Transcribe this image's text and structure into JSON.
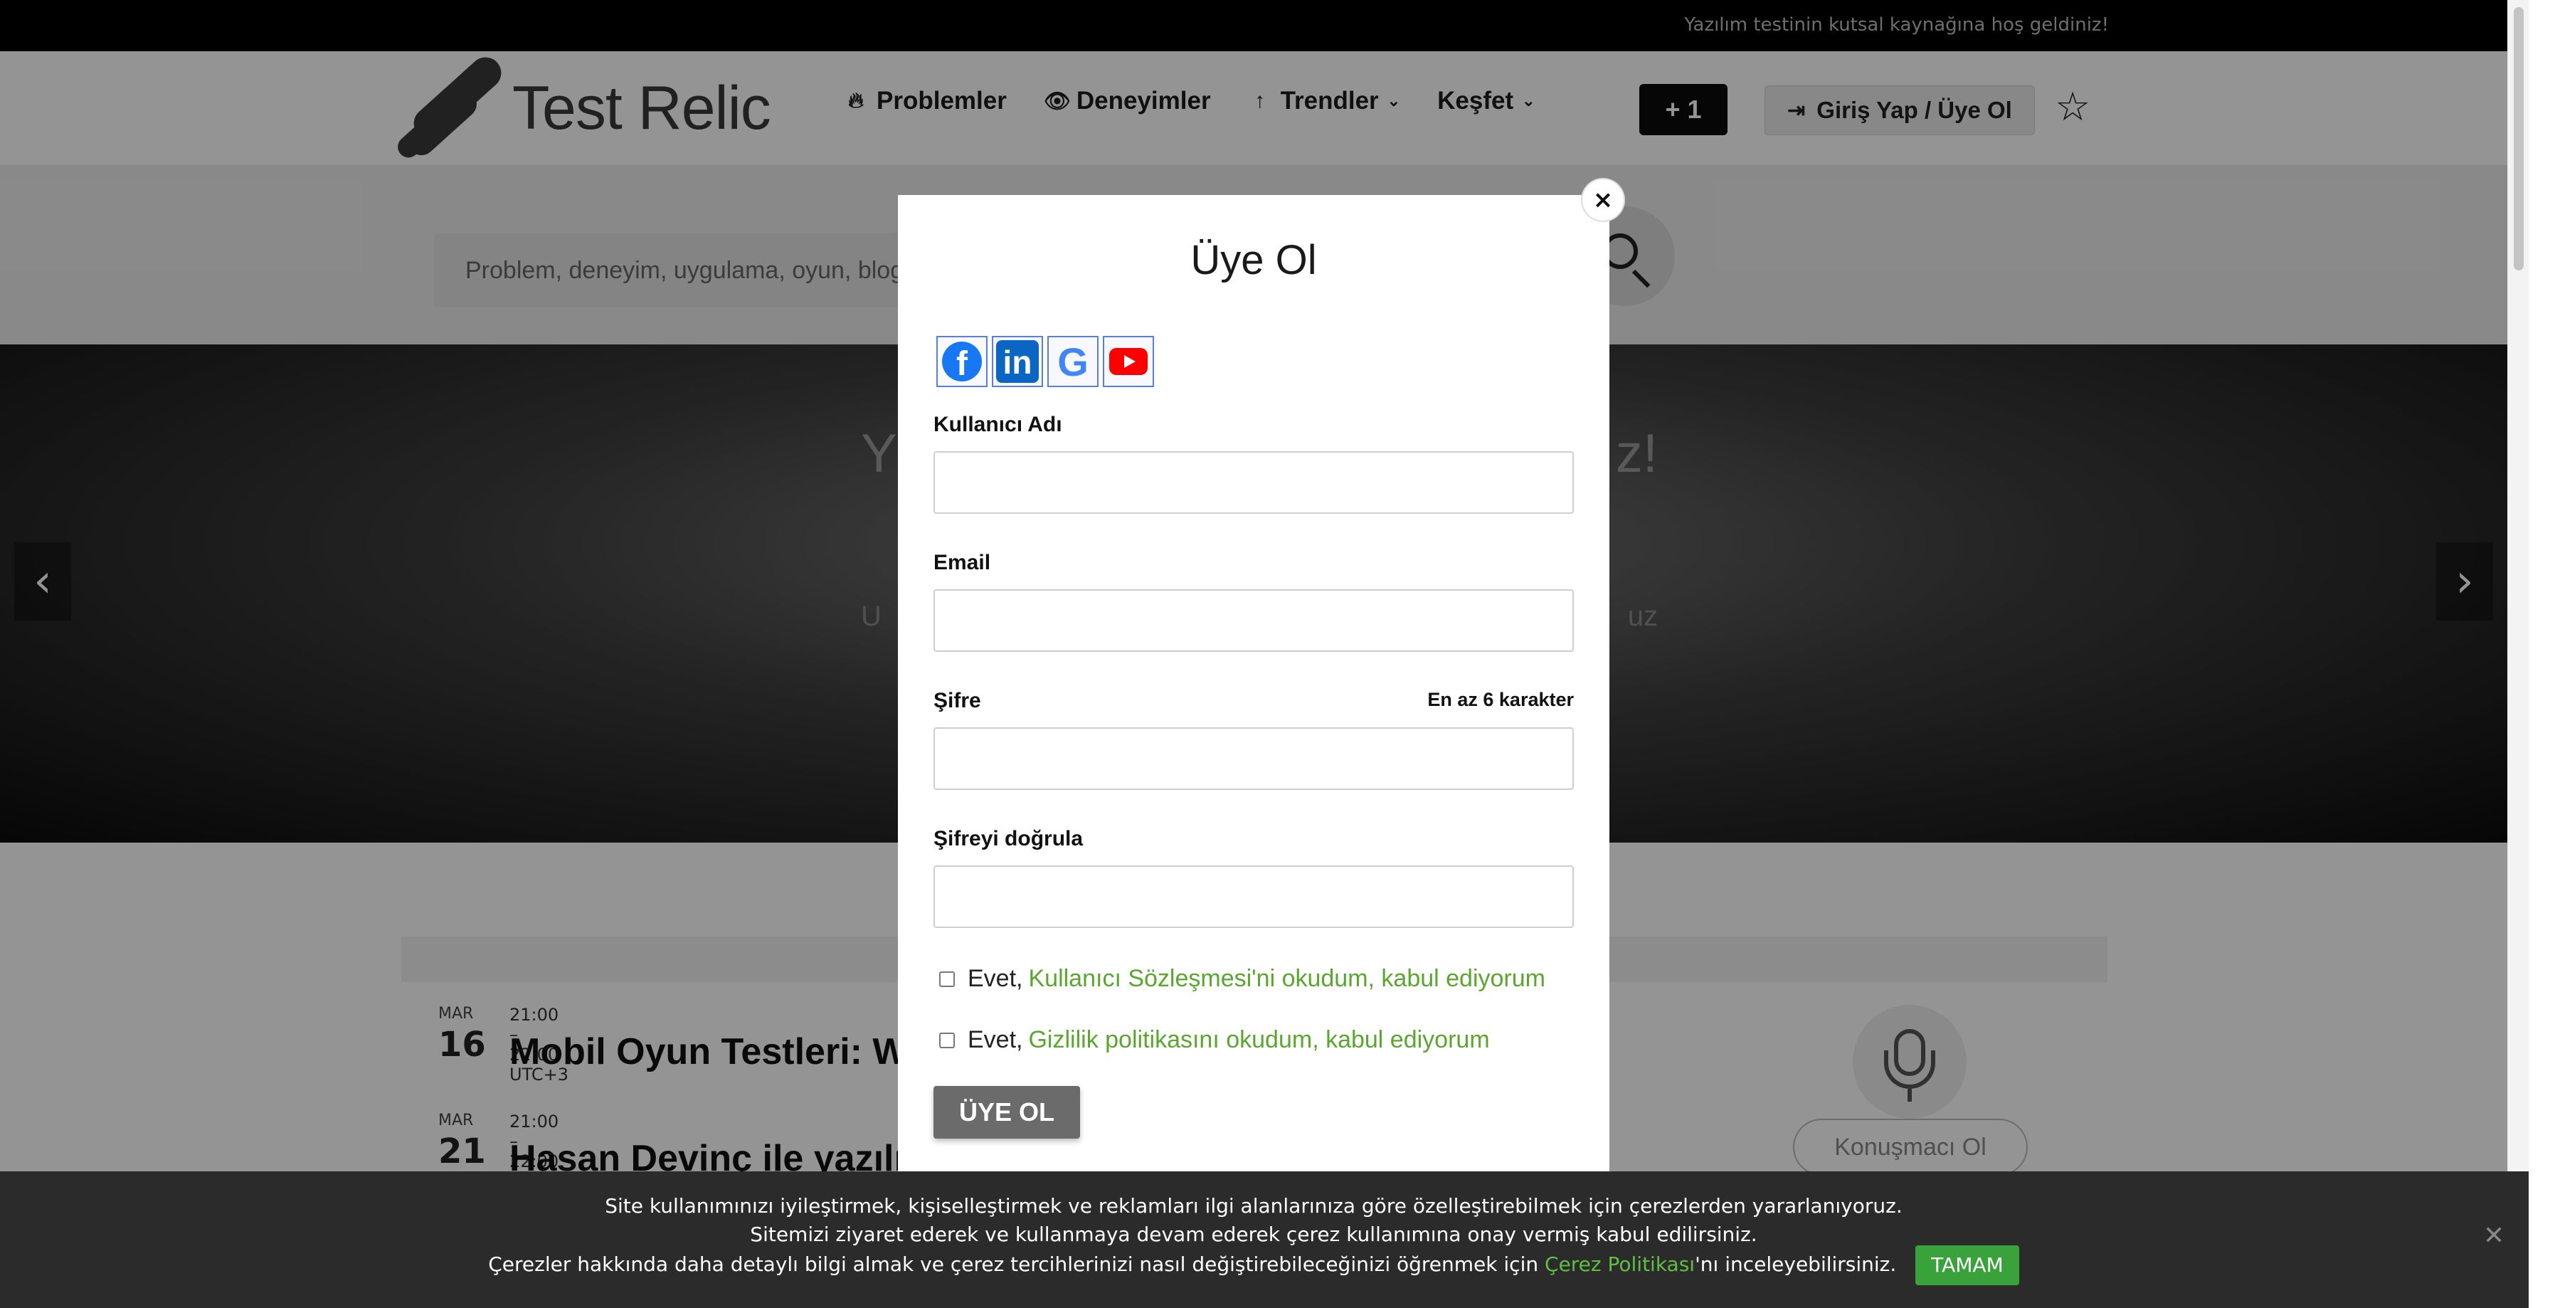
{
  "topbar": {
    "message": "Yazılım testinin kutsal kaynağına hoş geldiniz!"
  },
  "header": {
    "logo_text": "Test Relic",
    "nav": [
      {
        "label": "Problemler",
        "icon": "flame-icon"
      },
      {
        "label": "Deneyimler",
        "icon": "eye-icon"
      },
      {
        "label": "Trendler",
        "icon": "arrow-up-icon",
        "dropdown": true
      },
      {
        "label": "Keşfet",
        "dropdown": true
      }
    ],
    "plus_label": "+ 1",
    "login_label": "Giriş Yap / Üye Ol"
  },
  "search": {
    "placeholder": "Problem, deneyim, uygulama, oyun, blog"
  },
  "hero": {
    "title_left": "Y",
    "title_right": "z!",
    "sub_left": "U",
    "sub_right": "uz"
  },
  "events": [
    {
      "month": "MAR",
      "day": "16",
      "time": "21:00 – 22:00 UTC+3",
      "title": "Mobil Oyun Testleri: Wor"
    },
    {
      "month": "MAR",
      "day": "21",
      "time": "21:00 – 22:00 UTC+3",
      "title": "Hasan Devinç ile yazılım"
    }
  ],
  "speaker_label": "Konuşmacı Ol",
  "modal": {
    "title": "Üye Ol",
    "social": [
      "facebook-icon",
      "linkedin-icon",
      "google-icon",
      "youtube-icon"
    ],
    "username_label": "Kullanıcı Adı",
    "email_label": "Email",
    "password_label": "Şifre",
    "password_hint": "En az 6 karakter",
    "confirm_label": "Şifreyi doğrula",
    "terms_prefix": "Evet,",
    "terms_link": "Kullanıcı Sözleşmesi'ni okudum, kabul ediyorum",
    "privacy_prefix": "Evet,",
    "privacy_link": "Gizlilik politikasını okudum, kabul ediyorum",
    "submit_label": "ÜYE OL",
    "close_label": "×"
  },
  "cookie": {
    "line1": "Site kullanımınızı iyileştirmek, kişiselleştirmek ve reklamları ilgi alanlarınıza göre özelleştirebilmek için çerezlerden yararlanıyoruz.",
    "line2": "Sitemizi ziyaret ederek ve kullanmaya devam ederek çerez kullanımına onay vermiş kabul edilirsiniz.",
    "line3_prefix": "Çerezler hakkında daha detaylı bilgi almak ve çerez tercihlerinizi nasıl değiştirebileceğinizi öğrenmek için",
    "line3_link": "Çerez Politikası",
    "line3_suffix": "'nı inceleyebilirsiniz.",
    "ok_label": "TAMAM",
    "close_label": "✕"
  },
  "colors": {
    "accent_green": "#5aa62f",
    "cookie_button": "#3aa23a"
  }
}
